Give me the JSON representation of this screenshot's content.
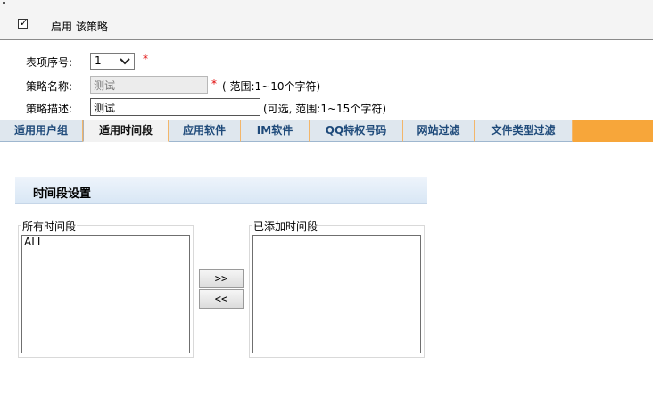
{
  "enable": {
    "label": "启用 该策略",
    "checked": true,
    "check_glyph": "✓"
  },
  "form": {
    "seq_label": "表项序号:",
    "seq_value": "1",
    "required_mark": "*",
    "name_label": "策略名称:",
    "name_value": "测试",
    "name_hint": "( 范围:1~10个字符)",
    "desc_label": "策略描述:",
    "desc_value": "测试",
    "desc_hint": "(可选, 范围:1~15个字符)"
  },
  "tabs": [
    {
      "label": "适用用户组",
      "active": false
    },
    {
      "label": "适用时间段",
      "active": true
    },
    {
      "label": "应用软件",
      "active": false
    },
    {
      "label": "IM软件",
      "active": false
    },
    {
      "label": "QQ特权号码",
      "active": false
    },
    {
      "label": "网站过滤",
      "active": false
    },
    {
      "label": "文件类型过滤",
      "active": false
    }
  ],
  "section": {
    "title": "时间段设置"
  },
  "all_periods": {
    "legend": "所有时间段",
    "items": [
      "ALL"
    ]
  },
  "added_periods": {
    "legend": "已添加时间段",
    "items": []
  },
  "buttons": {
    "add": ">>",
    "remove": "<<"
  },
  "colors": {
    "tab_bar": "#f7a63a",
    "tab_text": "#1e4a7a",
    "required": "#e00000"
  }
}
